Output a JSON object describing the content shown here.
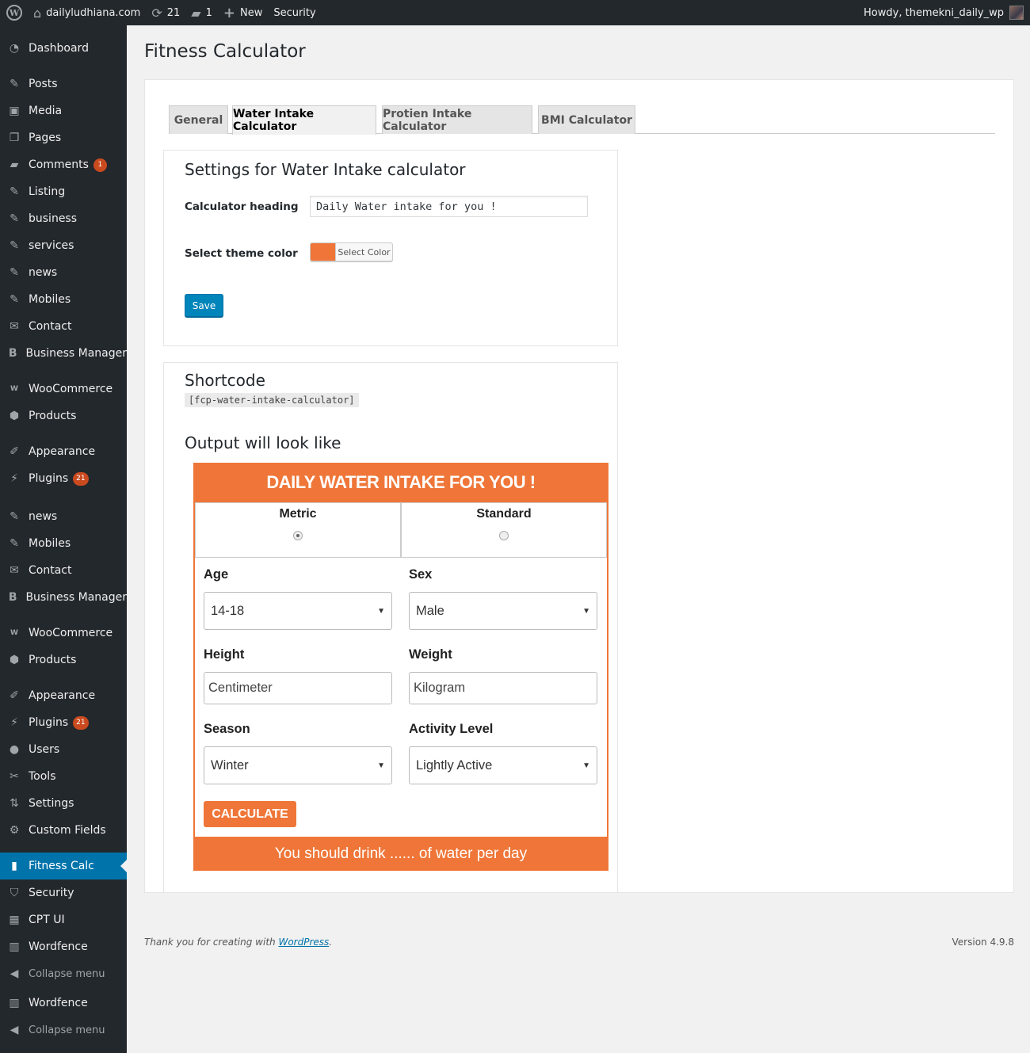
{
  "admin_bar": {
    "site_name": "dailyludhiana.com",
    "updates_count": "21",
    "comments_count": "1",
    "new_label": "New",
    "security_label": "Security",
    "greeting": "Howdy, themekni_daily_wp"
  },
  "sidebar": {
    "items": [
      {
        "label": "Dashboard",
        "icon": "dashboard-icon"
      },
      {
        "label": "Posts",
        "icon": "pin-icon"
      },
      {
        "label": "Media",
        "icon": "media-icon"
      },
      {
        "label": "Pages",
        "icon": "pages-icon"
      },
      {
        "label": "Comments",
        "icon": "comment-icon",
        "badge": "1"
      },
      {
        "label": "Listing",
        "icon": "pin-icon"
      },
      {
        "label": "business",
        "icon": "pin-icon"
      },
      {
        "label": "services",
        "icon": "pin-icon"
      },
      {
        "label": "news",
        "icon": "pin-icon"
      },
      {
        "label": "Mobiles",
        "icon": "pin-icon"
      },
      {
        "label": "Contact",
        "icon": "mail-icon"
      },
      {
        "label": "Business Manager",
        "icon": "b-letter-icon"
      },
      {
        "label": "WooCommerce",
        "icon": "woo-icon"
      },
      {
        "label": "Products",
        "icon": "box-icon"
      },
      {
        "label": "Appearance",
        "icon": "brush-icon"
      },
      {
        "label": "Plugins",
        "icon": "plug-icon",
        "badge": "21"
      },
      {
        "label": "news",
        "icon": "pin-icon"
      },
      {
        "label": "Mobiles",
        "icon": "pin-icon"
      },
      {
        "label": "Contact",
        "icon": "mail-icon"
      },
      {
        "label": "Business Manager",
        "icon": "b-letter-icon"
      },
      {
        "label": "WooCommerce",
        "icon": "woo-icon"
      },
      {
        "label": "Products",
        "icon": "box-icon"
      },
      {
        "label": "Appearance",
        "icon": "brush-icon"
      },
      {
        "label": "Plugins",
        "icon": "plug-icon",
        "badge": "21"
      },
      {
        "label": "Users",
        "icon": "user-icon"
      },
      {
        "label": "Tools",
        "icon": "wrench-icon"
      },
      {
        "label": "Settings",
        "icon": "sliders-icon"
      },
      {
        "label": "Custom Fields",
        "icon": "gear-icon"
      },
      {
        "label": "Fitness Calc",
        "icon": "bar-chart-icon",
        "active": true
      },
      {
        "label": "Security",
        "icon": "shield-icon"
      },
      {
        "label": "CPT UI",
        "icon": "grid-icon"
      },
      {
        "label": "Wordfence",
        "icon": "wordfence-icon"
      },
      {
        "label": "Collapse menu",
        "icon": "collapse-icon"
      },
      {
        "label": "Wordfence",
        "icon": "wordfence-icon"
      },
      {
        "label": "Collapse menu",
        "icon": "collapse-icon"
      }
    ]
  },
  "page": {
    "title": "Fitness Calculator",
    "tabs": [
      {
        "label": "General"
      },
      {
        "label": "Water Intake Calculator",
        "active": true
      },
      {
        "label": "Protien Intake Calculator"
      },
      {
        "label": "BMI Calculator"
      }
    ],
    "settings": {
      "heading": "Settings for Water Intake calculator",
      "calculator_heading_label": "Calculator heading",
      "calculator_heading_value": "Daily Water intake for you !",
      "theme_color_label": "Select theme color",
      "theme_color": "#ef7638",
      "select_color_label": "Select Color",
      "save_label": "Save"
    },
    "shortcode": {
      "heading": "Shortcode",
      "code": "[fcp-water-intake-calculator]",
      "output_heading": "Output will look like"
    }
  },
  "preview": {
    "title": "DAILY WATER INTAKE FOR YOU !",
    "units": [
      {
        "label": "Metric",
        "checked": true
      },
      {
        "label": "Standard",
        "checked": false
      }
    ],
    "age_label": "Age",
    "age_value": "14-18",
    "sex_label": "Sex",
    "sex_value": "Male",
    "height_label": "Height",
    "height_placeholder": "Centimeter",
    "weight_label": "Weight",
    "weight_placeholder": "Kilogram",
    "season_label": "Season",
    "season_value": "Winter",
    "activity_label": "Activity Level",
    "activity_value": "Lightly Active",
    "calculate_label": "CALCULATE",
    "result_text": "You should drink ...... of water per day"
  },
  "footer": {
    "thanks_prefix": "Thank you for creating with ",
    "wordpress_link": "WordPress",
    "thanks_suffix": ".",
    "version": "Version 4.9.8"
  }
}
